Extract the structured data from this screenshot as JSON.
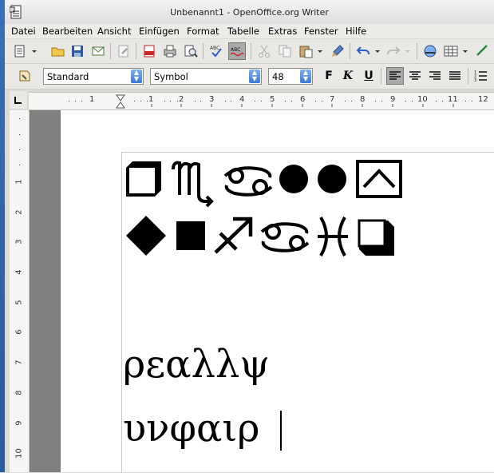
{
  "window": {
    "title": "Unbenannt1 - OpenOffice.org Writer"
  },
  "menu": [
    {
      "label": "Datei"
    },
    {
      "label": "Bearbeiten"
    },
    {
      "label": "Ansicht"
    },
    {
      "label": "Einfügen"
    },
    {
      "label": "Format"
    },
    {
      "label": "Tabelle"
    },
    {
      "label": "Extras"
    },
    {
      "label": "Fenster"
    },
    {
      "label": "Hilfe"
    }
  ],
  "formatting": {
    "paragraph_style": "Standard",
    "font_name": "Symbol",
    "font_size": "48",
    "bold_label": "F",
    "italic_label": "K",
    "underline_label": "U"
  },
  "ruler": {
    "h_numbers": [
      "1",
      "1",
      "2",
      "3",
      "4",
      "5",
      "6",
      "7",
      "8",
      "9",
      "10",
      "11",
      "12"
    ],
    "v_numbers": [
      "1",
      "2",
      "3",
      "4",
      "5",
      "6",
      "7",
      "8",
      "9",
      "10"
    ]
  },
  "document": {
    "symbol_line_1": "❐ ♏ ♋ ● ● ⌃",
    "symbol_line_2": "◆ ■ ♐ ♋ ♓ ❒",
    "greek_line_1": "ρεαλλψ",
    "greek_line_2": "υνφαιρ"
  },
  "colors": {
    "accent": "#3b78d4",
    "page": "#ffffff",
    "gray_margin": "#7f7f7f"
  }
}
